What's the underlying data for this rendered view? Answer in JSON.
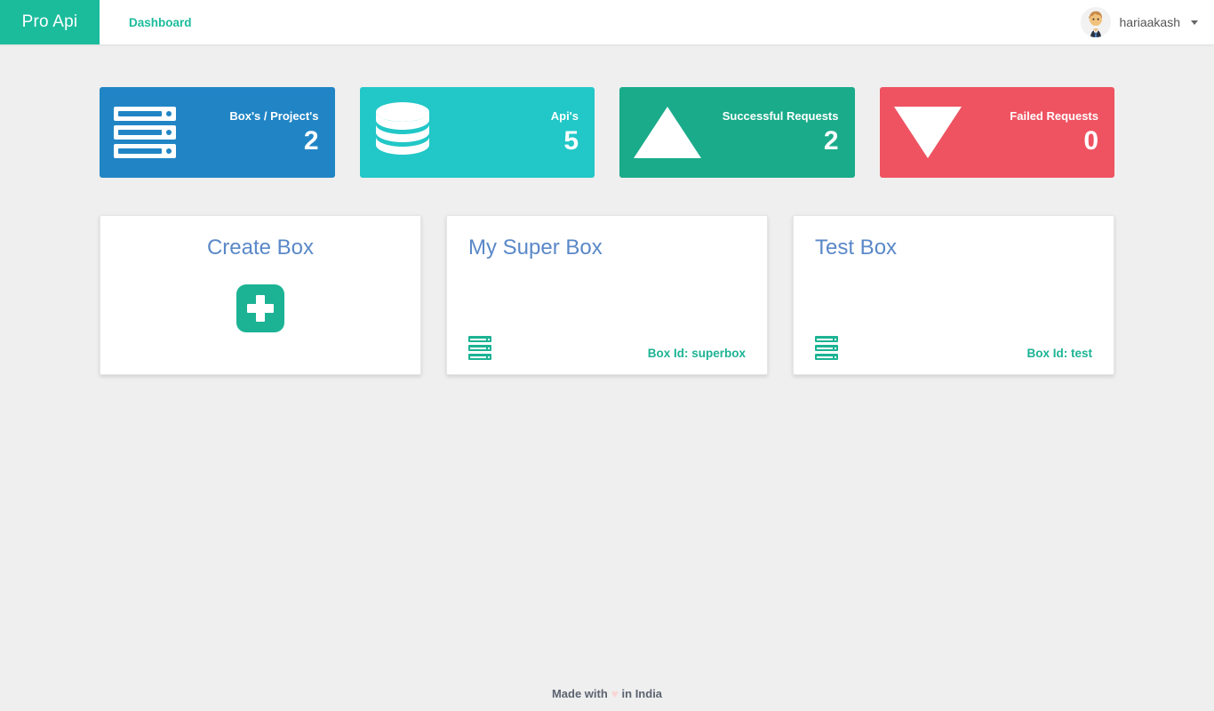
{
  "navbar": {
    "brand": "Pro Api",
    "links": [
      {
        "label": "Dashboard",
        "name": "nav-link-dashboard"
      }
    ],
    "user": {
      "name": "hariaakash",
      "avatar_icon": "person-avatar-icon",
      "caret_icon": "chevron-down-icon"
    }
  },
  "stats": [
    {
      "label": "Box's / Project's",
      "value": "2",
      "color": "#2185c5",
      "icon": "server-rack-icon"
    },
    {
      "label": "Api's",
      "value": "5",
      "color": "#22c7c7",
      "icon": "database-icon"
    },
    {
      "label": "Successful Requests",
      "value": "2",
      "color": "#1aab8a",
      "icon": "caret-up-icon"
    },
    {
      "label": "Failed Requests",
      "value": "0",
      "color": "#ef5361",
      "icon": "caret-down-icon"
    }
  ],
  "boxes": {
    "create": {
      "title": "Create Box",
      "icon": "plus-square-icon"
    },
    "items": [
      {
        "title": "My Super Box",
        "box_id_label": "Box Id: superbox",
        "icon": "server-rack-icon"
      },
      {
        "title": "Test Box",
        "box_id_label": "Box Id: test",
        "icon": "server-rack-icon"
      }
    ]
  },
  "footer": {
    "prefix": "Made with",
    "heart": "♥",
    "suffix": "in India"
  },
  "theme": {
    "brand_green": "#1abc9c",
    "accent_teal": "#1cb394",
    "title_blue": "#5a88c8",
    "page_bg": "#efefef",
    "heart_pink": "#fbd3d3"
  }
}
